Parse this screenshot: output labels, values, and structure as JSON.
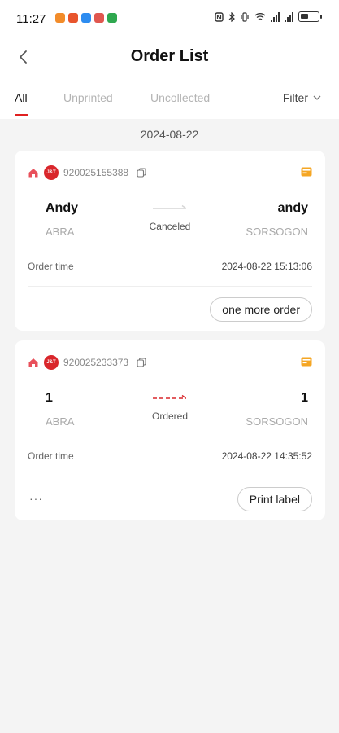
{
  "status_bar": {
    "time": "11:27"
  },
  "header": {
    "title": "Order List"
  },
  "tabs": [
    {
      "label": "All",
      "active": true
    },
    {
      "label": "Unprinted",
      "active": false
    },
    {
      "label": "Uncollected",
      "active": false
    }
  ],
  "filter_label": "Filter",
  "date_group": "2024-08-22",
  "orders": [
    {
      "waybill": "920025155388",
      "sender_name": "Andy",
      "sender_province": "ABRA",
      "receiver_name": "andy",
      "receiver_province": "SORSOGON",
      "status": "Canceled",
      "order_time_label": "Order time",
      "order_time": "2024-08-22 15:13:06",
      "action_label": "one more order"
    },
    {
      "waybill": "920025233373",
      "sender_name": "1",
      "sender_province": "ABRA",
      "receiver_name": "1",
      "receiver_province": "SORSOGON",
      "status": "Ordered",
      "order_time_label": "Order time",
      "order_time": "2024-08-22 14:35:52",
      "more_label": "···",
      "action_label": "Print label"
    }
  ],
  "colors": {
    "accent": "#e02020",
    "brand_logo": "#d9262b",
    "tag": "#f5a623"
  },
  "icons": {
    "back": "chevron-left-icon",
    "home": "home-icon",
    "logo": "jt-logo-icon",
    "copy": "copy-icon",
    "tag": "order-tag-icon",
    "filter": "chevron-down-icon"
  }
}
